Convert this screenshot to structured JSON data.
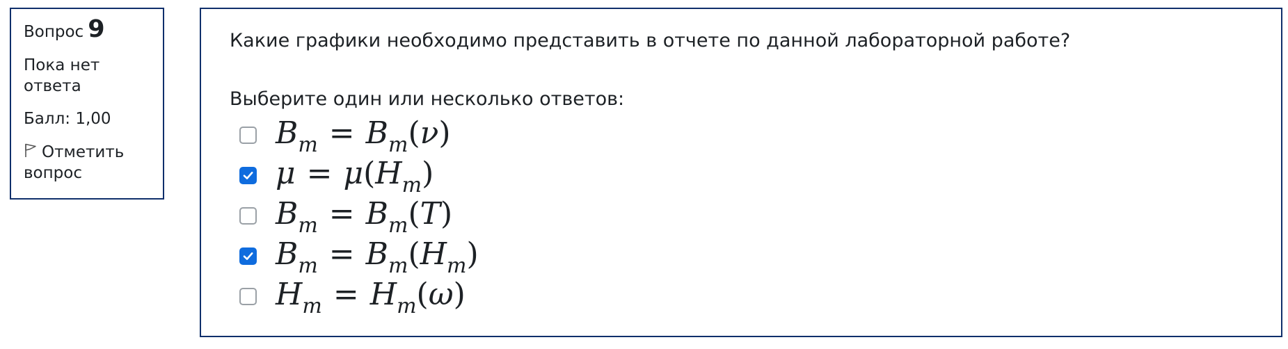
{
  "info": {
    "question_label": "Вопрос",
    "question_number": "9",
    "state": "Пока нет ответа",
    "grade": "Балл: 1,00",
    "flag_label": "Отметить вопрос"
  },
  "question": {
    "text": "Какие графики необходимо представить в отчете по данной лабораторной работе?",
    "prompt": "Выберите один или несколько ответов:"
  },
  "answers": [
    {
      "checked": false,
      "lhs_var": "B",
      "lhs_sub": "m",
      "op": "=",
      "rhs_var": "B",
      "rhs_sub": "m",
      "arg_var": "ν",
      "arg_sub": ""
    },
    {
      "checked": true,
      "lhs_var": "μ",
      "lhs_sub": "",
      "op": "=",
      "rhs_var": "μ",
      "rhs_sub": "",
      "arg_var": "H",
      "arg_sub": "m"
    },
    {
      "checked": false,
      "lhs_var": "B",
      "lhs_sub": "m",
      "op": "=",
      "rhs_var": "B",
      "rhs_sub": "m",
      "arg_var": "T",
      "arg_sub": ""
    },
    {
      "checked": true,
      "lhs_var": "B",
      "lhs_sub": "m",
      "op": "=",
      "rhs_var": "B",
      "rhs_sub": "m",
      "arg_var": "H",
      "arg_sub": "m"
    },
    {
      "checked": false,
      "lhs_var": "H",
      "lhs_sub": "m",
      "op": "=",
      "rhs_var": "H",
      "rhs_sub": "m",
      "arg_var": "ω",
      "arg_sub": ""
    }
  ],
  "colors": {
    "panel_border": "#0f2f6b",
    "checkbox_checked": "#0f6cde",
    "checkbox_unchecked_border": "#9aa0a6",
    "text": "#1d2125"
  },
  "icons": {
    "flag": "flag-outline-icon",
    "check": "checkmark-icon"
  }
}
